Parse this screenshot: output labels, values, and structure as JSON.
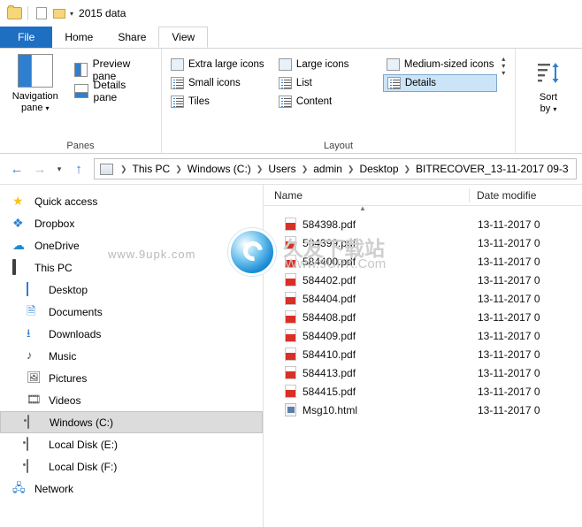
{
  "titlebar": {
    "title": "2015 data",
    "quick_access": [
      "folder-icon",
      "properties-icon",
      "new-folder-icon",
      "customize-caret"
    ]
  },
  "tabs": [
    {
      "label": "File",
      "type": "file"
    },
    {
      "label": "Home",
      "type": "normal"
    },
    {
      "label": "Share",
      "type": "normal"
    },
    {
      "label": "View",
      "type": "active"
    }
  ],
  "ribbon": {
    "panes": {
      "group_label": "Panes",
      "navigation_pane": "Navigation\npane",
      "navigation_pane_line1": "Navigation",
      "navigation_pane_line2": "pane",
      "preview_pane": "Preview pane",
      "details_pane": "Details pane"
    },
    "layout": {
      "group_label": "Layout",
      "items": [
        {
          "label": "Extra large icons",
          "selected": false
        },
        {
          "label": "Large icons",
          "selected": false
        },
        {
          "label": "Medium-sized icons",
          "selected": false
        },
        {
          "label": "Small icons",
          "selected": false
        },
        {
          "label": "List",
          "selected": false
        },
        {
          "label": "Details",
          "selected": true
        },
        {
          "label": "Tiles",
          "selected": false
        },
        {
          "label": "Content",
          "selected": false
        }
      ]
    },
    "sort": {
      "label_line1": "Sort",
      "label_line2": "by"
    }
  },
  "addressbar": {
    "back_icon": "back-arrow-icon",
    "forward_icon": "forward-arrow-icon",
    "recent_icon": "chevron-down-icon",
    "up_icon": "up-arrow-icon",
    "crumbs": [
      "This PC",
      "Windows (C:)",
      "Users",
      "admin",
      "Desktop",
      "BITRECOVER_13-11-2017 09-3"
    ]
  },
  "navpane": {
    "items": [
      {
        "label": "Quick access",
        "icon": "star-icon",
        "indent": 0,
        "selected": false
      },
      {
        "label": "Dropbox",
        "icon": "dropbox-icon",
        "indent": 0,
        "selected": false
      },
      {
        "label": "OneDrive",
        "icon": "cloud-icon",
        "indent": 0,
        "selected": false
      },
      {
        "label": "This PC",
        "icon": "computer-icon",
        "indent": 0,
        "selected": false
      },
      {
        "label": "Desktop",
        "icon": "desktop-icon",
        "indent": 1,
        "selected": false
      },
      {
        "label": "Documents",
        "icon": "documents-icon",
        "indent": 1,
        "selected": false
      },
      {
        "label": "Downloads",
        "icon": "downloads-icon",
        "indent": 1,
        "selected": false
      },
      {
        "label": "Music",
        "icon": "music-icon",
        "indent": 1,
        "selected": false
      },
      {
        "label": "Pictures",
        "icon": "pictures-icon",
        "indent": 1,
        "selected": false
      },
      {
        "label": "Videos",
        "icon": "videos-icon",
        "indent": 1,
        "selected": false
      },
      {
        "label": "Windows (C:)",
        "icon": "drive-icon",
        "indent": 1,
        "selected": true
      },
      {
        "label": "Local Disk (E:)",
        "icon": "drive-icon",
        "indent": 1,
        "selected": false
      },
      {
        "label": "Local Disk (F:)",
        "icon": "drive-icon",
        "indent": 1,
        "selected": false
      },
      {
        "label": "Network",
        "icon": "network-icon",
        "indent": 0,
        "selected": false
      }
    ]
  },
  "filelist": {
    "columns": [
      {
        "label": "Name",
        "sorted": true
      },
      {
        "label": "Date modifie"
      }
    ],
    "rows": [
      {
        "name": "584398.pdf",
        "icon": "pdf-icon",
        "date": "13-11-2017 0"
      },
      {
        "name": "584399.pdf",
        "icon": "pdf-icon",
        "date": "13-11-2017 0"
      },
      {
        "name": "584400.pdf",
        "icon": "pdf-icon",
        "date": "13-11-2017 0"
      },
      {
        "name": "584402.pdf",
        "icon": "pdf-icon",
        "date": "13-11-2017 0"
      },
      {
        "name": "584404.pdf",
        "icon": "pdf-icon",
        "date": "13-11-2017 0"
      },
      {
        "name": "584408.pdf",
        "icon": "pdf-icon",
        "date": "13-11-2017 0"
      },
      {
        "name": "584409.pdf",
        "icon": "pdf-icon",
        "date": "13-11-2017 0"
      },
      {
        "name": "584410.pdf",
        "icon": "pdf-icon",
        "date": "13-11-2017 0"
      },
      {
        "name": "584413.pdf",
        "icon": "pdf-icon",
        "date": "13-11-2017 0"
      },
      {
        "name": "584415.pdf",
        "icon": "pdf-icon",
        "date": "13-11-2017 0"
      },
      {
        "name": "Msg10.html",
        "icon": "html-icon",
        "date": "13-11-2017 0"
      }
    ]
  },
  "watermark": {
    "left_text": "www.9upk.com",
    "title": "久友下载站",
    "subtitle": "Www.9UPK.Com"
  }
}
